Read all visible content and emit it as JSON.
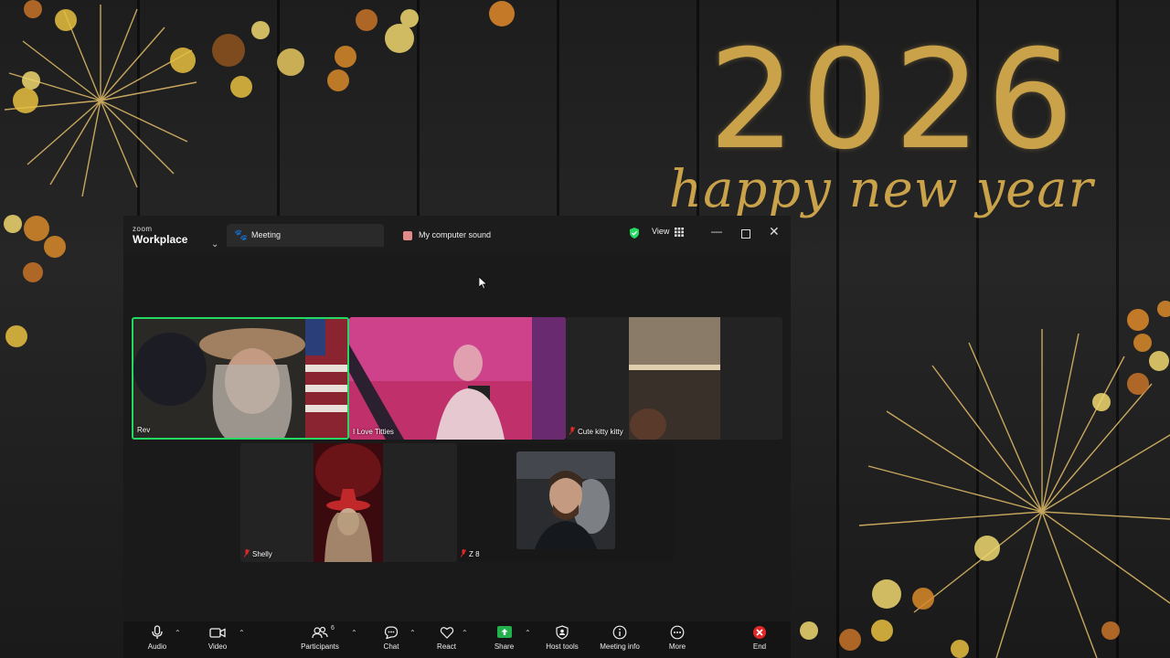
{
  "wallpaper": {
    "year": "2026",
    "greeting": "happy new year"
  },
  "window": {
    "brand_small": "zoom",
    "brand_big": "Workplace",
    "tabs": [
      {
        "label": "Meeting",
        "icon": "paw-icon"
      },
      {
        "label": "My computer sound",
        "icon": "audio-share-icon"
      }
    ],
    "view_label": "View"
  },
  "participants": [
    {
      "name": "Rev",
      "muted": false,
      "active": true
    },
    {
      "name": "I Love Titties",
      "muted": false,
      "active": false
    },
    {
      "name": "Cute kitty kitty",
      "muted": true,
      "active": false
    },
    {
      "name": "Shelly",
      "muted": true,
      "active": false
    },
    {
      "name": "Z 8",
      "muted": true,
      "active": false
    },
    {
      "name": "",
      "muted": false,
      "active": false
    }
  ],
  "toolbar": {
    "audio": "Audio",
    "video": "Video",
    "participants": "Participants",
    "participants_count": "6",
    "chat": "Chat",
    "react": "React",
    "share": "Share",
    "host_tools": "Host tools",
    "meeting_info": "Meeting info",
    "more": "More",
    "end": "End"
  },
  "colors": {
    "active_speaker": "#23d962",
    "share_green": "#22b14c",
    "end_red": "#e02828",
    "gold": "#c9a24a"
  }
}
